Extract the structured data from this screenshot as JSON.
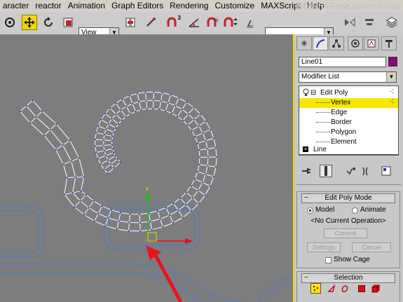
{
  "menu": {
    "items": [
      "aracter",
      "reactor",
      "Animation",
      "Graph Editors",
      "Rendering",
      "Customize",
      "MAXScript",
      "Help"
    ],
    "watermark": "思缘设计论坛 www.MISSVUAN.COM"
  },
  "toolbar": {
    "view_label": "View",
    "snap_label": "3",
    "selection_set_placeholder": ""
  },
  "panel": {
    "object_name": "Line01",
    "object_color": "#8a0a7a",
    "modifier_list": "Modifier List",
    "stack": {
      "edit_poly": "Edit Poly",
      "sub_vertex": "Vertex",
      "sub_edge": "Edge",
      "sub_border": "Border",
      "sub_polygon": "Polygon",
      "sub_element": "Element",
      "line": "Line",
      "expand_minus": "⊟",
      "expand_plus": "+"
    },
    "edit_poly_mode": {
      "header": "Edit Poly Mode",
      "model_label": "Model",
      "animate_label": "Animate",
      "current_op": "<No Current Operation>",
      "commit_label": "Commit",
      "settings_label": "Settings",
      "cancel_label": "Cancel",
      "show_cage_label": "Show Cage"
    },
    "selection": {
      "header": "Selection"
    }
  },
  "colors": {
    "accent_yellow": "#f8e800",
    "viewport_bg": "#7d7d7d",
    "wire": "#ffffff",
    "vertex": "#3a34d6",
    "arrow": "#e8141e"
  }
}
